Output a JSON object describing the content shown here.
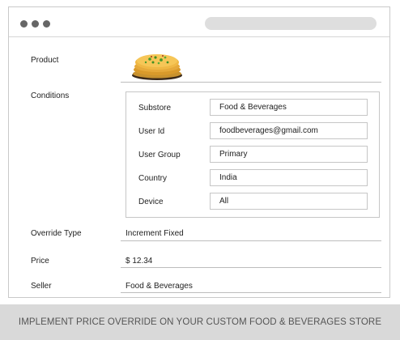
{
  "form": {
    "product_label": "Product",
    "conditions_label": "Conditions",
    "conditions": [
      {
        "label": "Substore",
        "value": "Food & Beverages"
      },
      {
        "label": "User Id",
        "value": "foodbeverages@gmail.com"
      },
      {
        "label": "User Group",
        "value": "Primary"
      },
      {
        "label": "Country",
        "value": "India"
      },
      {
        "label": "Device",
        "value": "All"
      }
    ],
    "override_type_label": "Override Type",
    "override_type_value": "Increment Fixed",
    "price_label": "Price",
    "price_value": "$ 12.34",
    "seller_label": "Seller",
    "seller_value": "Food & Beverages"
  },
  "footer": {
    "caption": "IMPLEMENT PRICE OVERRIDE ON YOUR CUSTOM FOOD & BEVERAGES STORE"
  },
  "icons": {
    "window_controls": [
      "dot-icon",
      "dot-icon",
      "dot-icon"
    ],
    "product_image": "food-plate-image"
  }
}
